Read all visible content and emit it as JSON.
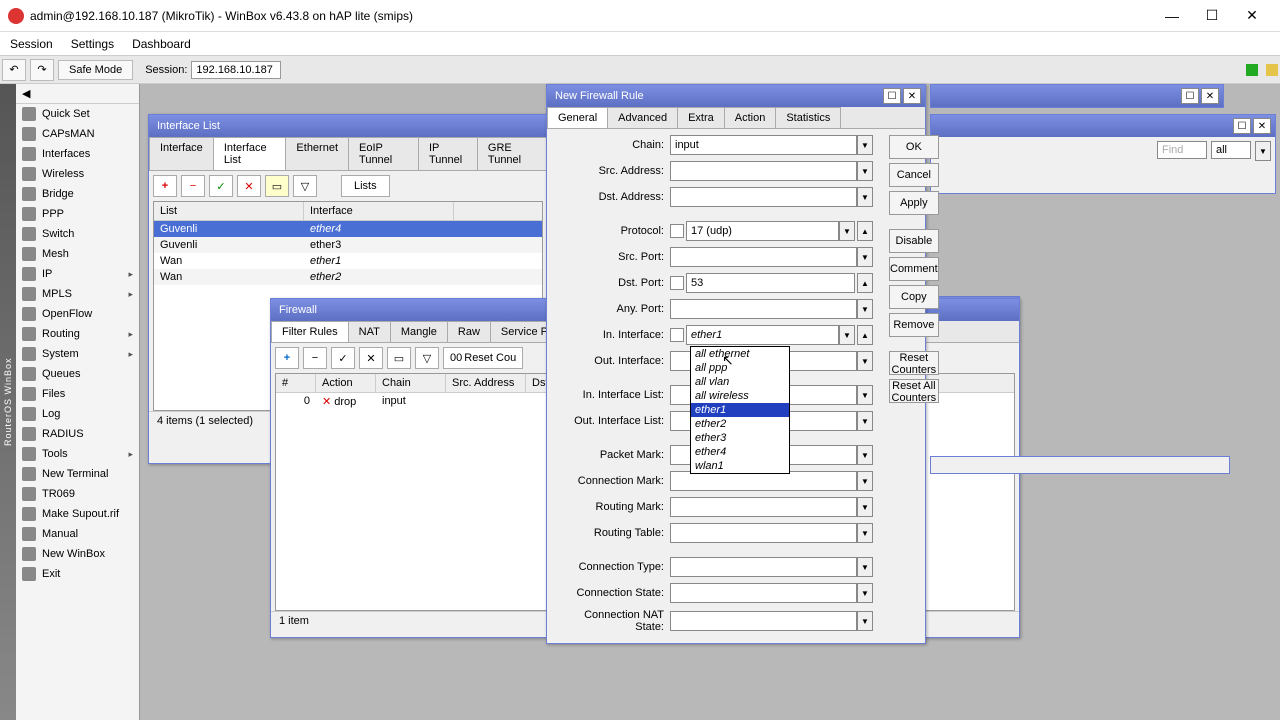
{
  "titlebar": {
    "title": "admin@192.168.10.187 (MikroTik) - WinBox v6.43.8 on hAP lite (smips)"
  },
  "menubar": [
    "Session",
    "Settings",
    "Dashboard"
  ],
  "toolbar": {
    "safe_mode": "Safe Mode",
    "session_label": "Session:",
    "session_value": "192.168.10.187"
  },
  "sidebar": {
    "items": [
      {
        "label": "Quick Set",
        "arrow": false
      },
      {
        "label": "CAPsMAN",
        "arrow": false
      },
      {
        "label": "Interfaces",
        "arrow": false
      },
      {
        "label": "Wireless",
        "arrow": false
      },
      {
        "label": "Bridge",
        "arrow": false
      },
      {
        "label": "PPP",
        "arrow": false
      },
      {
        "label": "Switch",
        "arrow": false
      },
      {
        "label": "Mesh",
        "arrow": false
      },
      {
        "label": "IP",
        "arrow": true
      },
      {
        "label": "MPLS",
        "arrow": true
      },
      {
        "label": "OpenFlow",
        "arrow": false
      },
      {
        "label": "Routing",
        "arrow": true
      },
      {
        "label": "System",
        "arrow": true
      },
      {
        "label": "Queues",
        "arrow": false
      },
      {
        "label": "Files",
        "arrow": false
      },
      {
        "label": "Log",
        "arrow": false
      },
      {
        "label": "RADIUS",
        "arrow": false
      },
      {
        "label": "Tools",
        "arrow": true
      },
      {
        "label": "New Terminal",
        "arrow": false
      },
      {
        "label": "TR069",
        "arrow": false
      },
      {
        "label": "Make Supout.rif",
        "arrow": false
      },
      {
        "label": "Manual",
        "arrow": false
      },
      {
        "label": "New WinBox",
        "arrow": false
      },
      {
        "label": "Exit",
        "arrow": false
      }
    ]
  },
  "sidebar_vert": "RouterOS WinBox",
  "iflist": {
    "title": "Interface List",
    "tabs": [
      "Interface",
      "Interface List",
      "Ethernet",
      "EoIP Tunnel",
      "IP Tunnel",
      "GRE Tunnel"
    ],
    "active_tab": 1,
    "lists_btn": "Lists",
    "headers": [
      "List",
      "Interface"
    ],
    "rows": [
      {
        "list": "Guvenli",
        "iface": "ether4",
        "sel": true,
        "italic": true
      },
      {
        "list": "Guvenli",
        "iface": "ether3",
        "sel": false,
        "italic": false
      },
      {
        "list": "Wan",
        "iface": "ether1",
        "sel": false,
        "italic": true
      },
      {
        "list": "Wan",
        "iface": "ether2",
        "sel": false,
        "italic": true
      }
    ],
    "status": "4 items (1 selected)"
  },
  "firewall": {
    "title": "Firewall",
    "tabs": [
      "Filter Rules",
      "NAT",
      "Mangle",
      "Raw",
      "Service Ports"
    ],
    "reset_btn": "Reset Cou",
    "headers": [
      "#",
      "Action",
      "Chain",
      "Src. Address",
      "Dst."
    ],
    "row": {
      "num": "0",
      "action": "drop",
      "chain": "input"
    },
    "status": "1 item"
  },
  "newrule": {
    "title": "New Firewall Rule",
    "tabs": [
      "General",
      "Advanced",
      "Extra",
      "Action",
      "Statistics"
    ],
    "fields": {
      "chain_lbl": "Chain:",
      "chain_val": "input",
      "srcaddr_lbl": "Src. Address:",
      "srcaddr_val": "",
      "dstaddr_lbl": "Dst. Address:",
      "dstaddr_val": "",
      "proto_lbl": "Protocol:",
      "proto_val": "17 (udp)",
      "srcport_lbl": "Src. Port:",
      "srcport_val": "",
      "dstport_lbl": "Dst. Port:",
      "dstport_val": "53",
      "anyport_lbl": "Any. Port:",
      "anyport_val": "",
      "iniface_lbl": "In. Interface:",
      "iniface_val": "ether1",
      "outiface_lbl": "Out. Interface:",
      "outiface_val": "",
      "inifacelist_lbl": "In. Interface List:",
      "inifacelist_val": "",
      "outifacelist_lbl": "Out. Interface List:",
      "outifacelist_val": "",
      "pktmark_lbl": "Packet Mark:",
      "pktmark_val": "",
      "connmark_lbl": "Connection Mark:",
      "connmark_val": "",
      "rtmark_lbl": "Routing Mark:",
      "rtmark_val": "",
      "rttbl_lbl": "Routing Table:",
      "rttbl_val": "",
      "conntype_lbl": "Connection Type:",
      "conntype_val": "",
      "connstate_lbl": "Connection State:",
      "connstate_val": "",
      "connnat_lbl": "Connection NAT State:",
      "connnat_val": ""
    },
    "buttons": [
      "OK",
      "Cancel",
      "Apply",
      "Disable",
      "Comment",
      "Copy",
      "Remove",
      "Reset Counters",
      "Reset All Counters"
    ]
  },
  "dropdown": {
    "items": [
      {
        "label": "all ethernet",
        "sel": false
      },
      {
        "label": "all ppp",
        "sel": false
      },
      {
        "label": "all vlan",
        "sel": false
      },
      {
        "label": "all wireless",
        "sel": false
      },
      {
        "label": "ether1",
        "sel": true
      },
      {
        "label": "ether2",
        "sel": false
      },
      {
        "label": "ether3",
        "sel": false
      },
      {
        "label": "ether4",
        "sel": false
      },
      {
        "label": "wlan1",
        "sel": false
      }
    ]
  },
  "bg": {
    "find": "Find",
    "all": "all",
    "zero": "0"
  }
}
